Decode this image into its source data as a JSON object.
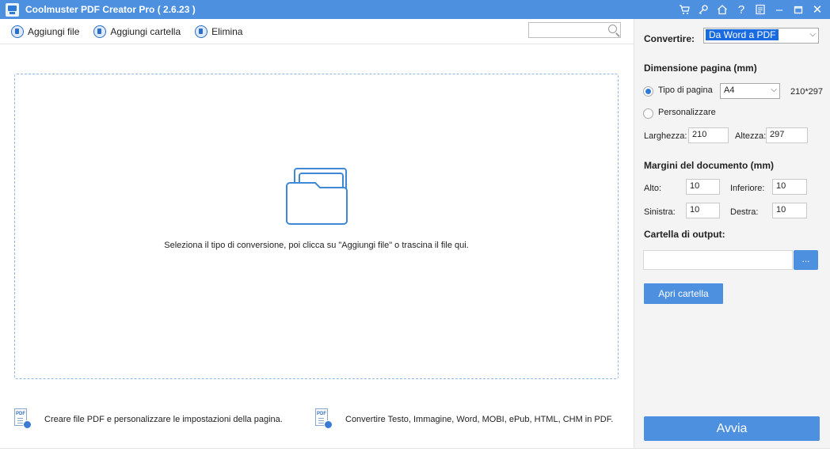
{
  "window": {
    "title": "Coolmuster PDF Creator Pro   ( 2.6.23 )",
    "controls": [
      "cart-icon",
      "key-icon",
      "home-icon",
      "help-icon",
      "feedback-icon",
      "minimize-icon",
      "restore-icon",
      "close-icon"
    ],
    "help_glyph": "?",
    "minimize_glyph": "–",
    "close_glyph": "✕"
  },
  "toolbar": {
    "add_file_label": "Aggiungi file",
    "add_folder_label": "Aggiungi cartella",
    "delete_label": "Elimina",
    "search_value": ""
  },
  "dropzone": {
    "hint": "Seleziona il tipo di conversione, poi clicca su \"Aggiungi file\" o trascina il file qui."
  },
  "tips": {
    "tip1": "Creare file PDF e personalizzare le impostazioni della pagina.",
    "tip2": "Convertire Testo, Immagine, Word, MOBI, ePub, HTML, CHM in PDF.",
    "pdf_badge": "PDF"
  },
  "panel": {
    "convert_label": "Convertire:",
    "convert_value": "Da Word a PDF",
    "page_size_title": "Dimensione pagina (mm)",
    "page_type_label": "Tipo di pagina",
    "page_type_value": "A4",
    "page_type_dims": "210*297",
    "custom_label": "Personalizzare",
    "width_label": "Larghezza:",
    "width_value": "210",
    "height_label": "Altezza:",
    "height_value": "297",
    "margins_title": "Margini del documento (mm)",
    "top_label": "Alto:",
    "top_value": "10",
    "bottom_label": "Inferiore:",
    "bottom_value": "10",
    "left_label": "Sinistra:",
    "left_value": "10",
    "right_label": "Destra:",
    "right_value": "10",
    "output_title": "Cartella di output:",
    "output_value": "",
    "browse_label": "...",
    "open_folder_label": "Apri cartella",
    "start_label": "Avvia",
    "dropdown_glyph": "⌵"
  },
  "colors": {
    "accent": "#4d90e0",
    "selection": "#1a6be0",
    "panel_bg": "#f4f4f4"
  }
}
